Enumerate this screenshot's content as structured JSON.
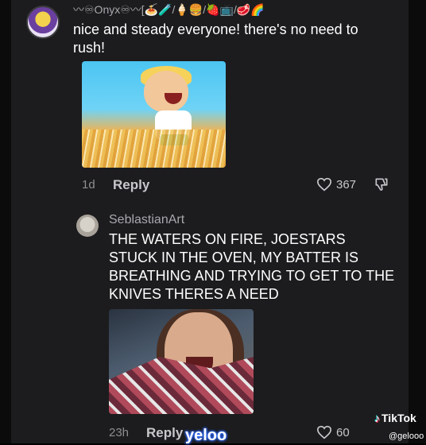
{
  "comments": [
    {
      "username": "〰♾Onyx♾〰[🍝🧪/🍦🍔/🍓📺/🥩🌈",
      "text": "nice and steady everyone! there's no need to rush!",
      "age": "1d",
      "reply_label": "Reply",
      "likes": "367",
      "image_icon": "cartoon-boy-running-in-field"
    },
    {
      "username": "SeblastianArt",
      "text": "THE WATERS ON FIRE, JOESTARS STUCK IN THE OVEN, MY BATTER IS BREATHING AND TRYING TO GET TO THE KNIVES THERES A NEED",
      "age": "23h",
      "reply_label": "Reply",
      "likes": "60",
      "image_icon": "screaming-woman-webcam"
    }
  ],
  "overlay": {
    "caption": "yeloo",
    "watermark_brand": "TikTok",
    "watermark_handle": "@gelooo"
  },
  "colors": {
    "background": "#1c1c1e",
    "caption_glow": "#2f6bff",
    "muted_text": "#8e8e93"
  }
}
